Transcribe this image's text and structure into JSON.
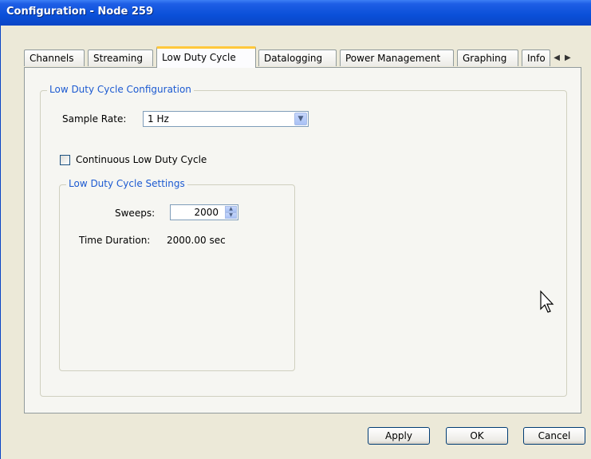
{
  "window": {
    "title": "Configuration - Node 259"
  },
  "tabs": [
    {
      "label": "Channels",
      "active": false
    },
    {
      "label": "Streaming",
      "active": false
    },
    {
      "label": "Low Duty Cycle",
      "active": true
    },
    {
      "label": "Datalogging",
      "active": false
    },
    {
      "label": "Power Management",
      "active": false
    },
    {
      "label": "Graphing",
      "active": false
    },
    {
      "label": "Info",
      "active": false
    }
  ],
  "low_duty_cycle_config": {
    "group_title": "Low Duty Cycle Configuration",
    "sample_rate_label": "Sample Rate:",
    "sample_rate_value": "1 Hz",
    "continuous_label": "Continuous Low Duty Cycle",
    "continuous_checked": false
  },
  "low_duty_cycle_settings": {
    "group_title": "Low Duty Cycle Settings",
    "sweeps_label": "Sweeps:",
    "sweeps_value": "2000",
    "time_duration_label": "Time Duration:",
    "time_duration_value": "2000.00 sec"
  },
  "buttons": {
    "apply": "Apply",
    "ok": "OK",
    "cancel": "Cancel"
  }
}
